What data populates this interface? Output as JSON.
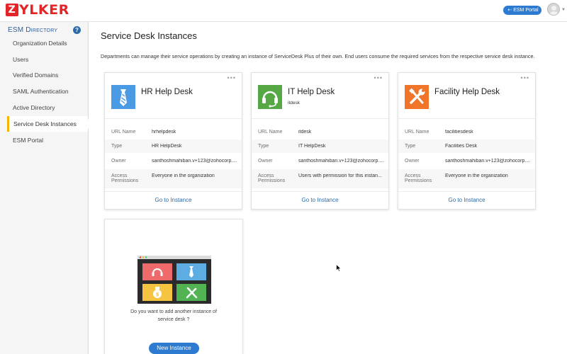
{
  "brand": {
    "logo_text": "ZYLKER",
    "accent": "#e42527"
  },
  "header": {
    "portal_button": "ESM Portal",
    "portal_icon": "arrow-left-icon",
    "user_avatar": "avatar-icon"
  },
  "sidebar": {
    "title": "ESM Directory",
    "help": "?",
    "items": [
      {
        "label": "Organization Details"
      },
      {
        "label": "Users"
      },
      {
        "label": "Verified Domains"
      },
      {
        "label": "SAML Authentication"
      },
      {
        "label": "Active Directory"
      },
      {
        "label": "Service Desk Instances",
        "active": true
      },
      {
        "label": "ESM Portal"
      }
    ]
  },
  "main": {
    "title": "Service Desk Instances",
    "description": "Departments can manage their service operations by creating an instance of ServiceDesk Plus of their own. End users consume the required services from the respective service desk instance.",
    "labels": {
      "url_name": "URL Name",
      "type": "Type",
      "owner": "Owner",
      "access_1": "Access",
      "access_2": "Permissions",
      "menu": "•••",
      "go": "Go to Instance"
    },
    "cards": [
      {
        "title": "HR Help Desk",
        "subtitle": "",
        "icon": "tie-icon",
        "color": "#4a9be4",
        "url_name": "hrhelpdesk",
        "type": "HR HelpDesk",
        "owner": "santhoshmahiban.v+123@zohocorp....",
        "access": "Everyone in the organization"
      },
      {
        "title": "IT Help Desk",
        "subtitle": "itdesk",
        "icon": "headset-icon",
        "color": "#55a844",
        "url_name": "itdesk",
        "type": "IT HelpDesk",
        "owner": "santhoshmahiban.v+123@zohocorp....",
        "access": "Users with permission for this instan..."
      },
      {
        "title": "Facility Help Desk",
        "subtitle": "",
        "icon": "tools-icon",
        "color": "#f0752a",
        "url_name": "facilitiesdesk",
        "type": "Facilities Desk",
        "owner": "santhoshmahiban.v+123@zohocorp....",
        "access": "Everyone in the organization"
      }
    ],
    "new_instance": {
      "prompt_line1": "Do you want to add another instance of",
      "prompt_line2": "service desk ?",
      "button": "New Instance"
    }
  }
}
